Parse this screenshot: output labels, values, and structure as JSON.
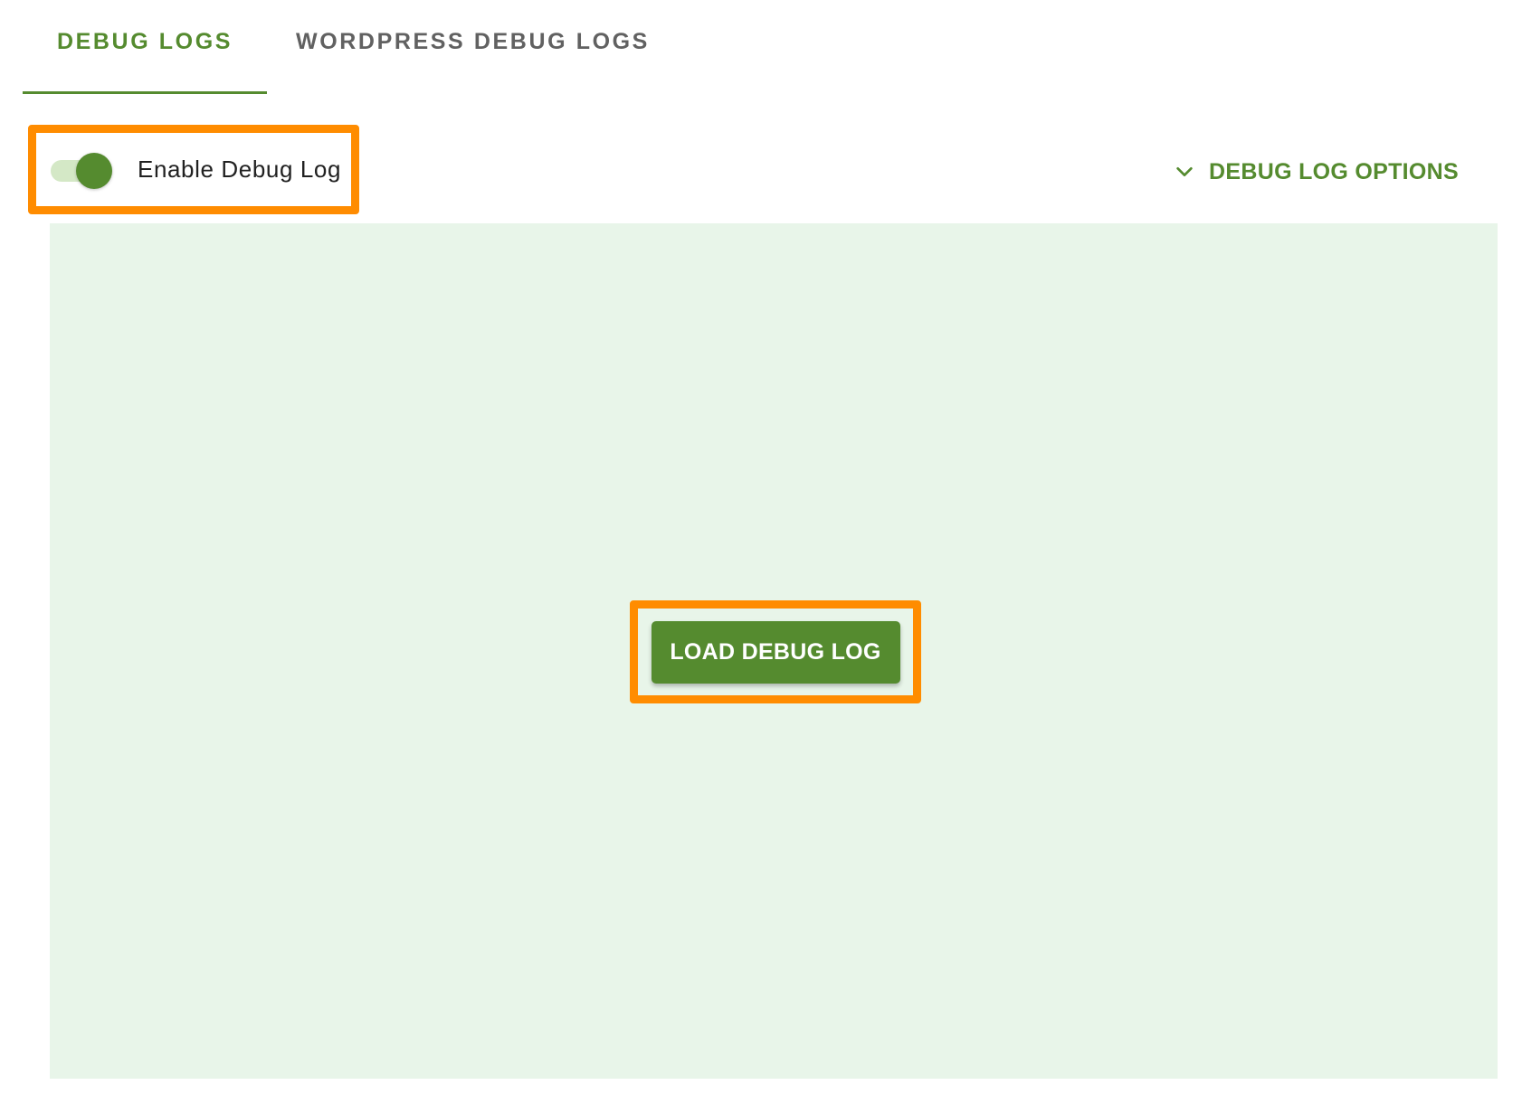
{
  "tabs": [
    {
      "label": "DEBUG LOGS",
      "active": true
    },
    {
      "label": "WORDPRESS DEBUG LOGS",
      "active": false
    }
  ],
  "toggle": {
    "label": "Enable Debug Log",
    "checked": true
  },
  "options": {
    "label": "DEBUG LOG OPTIONS",
    "icon": "chevron-down-icon"
  },
  "log_panel": {
    "load_button_label": "LOAD DEBUG LOG"
  },
  "colors": {
    "accent": "#558b2f",
    "highlight": "#ff8c00",
    "panel_background": "#e8f5e9",
    "inactive_tab": "#616161"
  }
}
